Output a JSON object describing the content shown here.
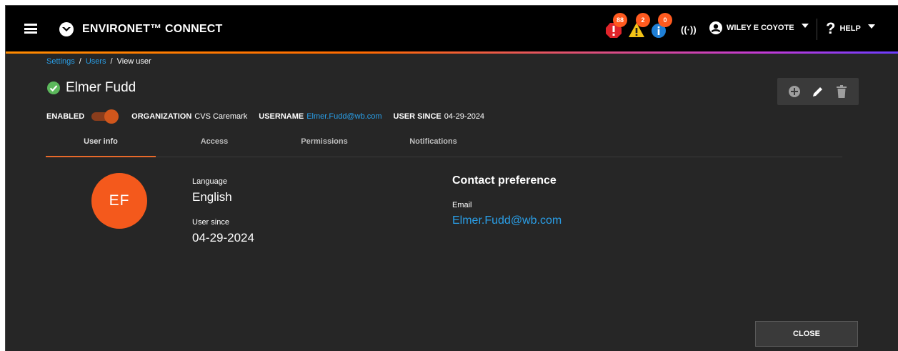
{
  "header": {
    "app_title": "ENVIRONET™ CONNECT",
    "alerts": {
      "critical_count": "88",
      "warning_count": "2",
      "info_count": "0"
    },
    "user_name": "WILEY E COYOTE",
    "help_label": "HELP",
    "icons": [
      "menu-icon",
      "logo-icon",
      "critical-alert-icon",
      "warning-icon",
      "info-icon",
      "signal-icon",
      "user-circle-icon",
      "help-icon"
    ],
    "accent_gradient": [
      "#ff8a00",
      "#c23bd6",
      "#6b3cff"
    ]
  },
  "breadcrumb": {
    "items": [
      "Settings",
      "Users",
      "View user"
    ],
    "separator": "/"
  },
  "user": {
    "name": "Elmer Fudd",
    "initials": "EF",
    "enabled_label": "ENABLED",
    "enabled": true,
    "organization_label": "ORGANIZATION",
    "organization": "CVS Caremark",
    "username_label": "USERNAME",
    "username": "Elmer.Fudd@wb.com",
    "user_since_label": "USER SINCE",
    "user_since": "04-29-2024"
  },
  "tabs": [
    "User info",
    "Access",
    "Permissions",
    "Notifications"
  ],
  "active_tab": "User info",
  "user_info": {
    "language_label": "Language",
    "language": "English",
    "user_since_label": "User since",
    "user_since": "04-29-2024"
  },
  "contact": {
    "title": "Contact preference",
    "email_label": "Email",
    "email": "Elmer.Fudd@wb.com"
  },
  "close_label": "CLOSE",
  "colors": {
    "accent_orange": "#f4591c",
    "link_blue": "#2a9fe8",
    "success_green": "#5cb85c",
    "background": "#262626"
  }
}
